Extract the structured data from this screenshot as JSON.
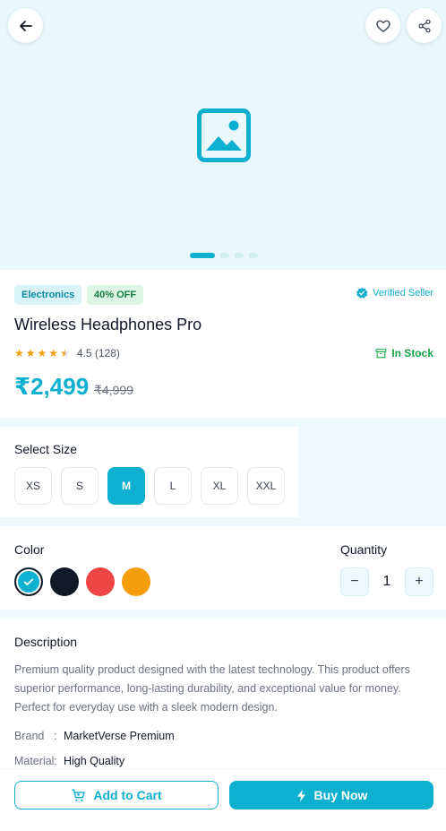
{
  "product": {
    "category": "Electronics",
    "discount": "40% OFF",
    "seller": "Verified Seller",
    "title": "Wireless Headphones Pro",
    "rating": "4.5",
    "reviews": "(128)",
    "rating_value": 4.5,
    "stock": "In Stock",
    "price": "₹2,499",
    "old_price": "₹4,999"
  },
  "gallery": {
    "active_index": 0,
    "count": 4
  },
  "size": {
    "label": "Select Size",
    "options": [
      "XS",
      "S",
      "M",
      "L",
      "XL",
      "XXL"
    ],
    "selected": "M"
  },
  "color": {
    "label": "Color",
    "options": [
      "#0eb0cf",
      "#111827",
      "#ef4444",
      "#f59e0b"
    ],
    "selected_index": 0
  },
  "quantity": {
    "label": "Quantity",
    "value": "1",
    "minus": "−",
    "plus": "+"
  },
  "description": {
    "title": "Description",
    "text": "Premium quality product designed with the latest technology. This product offers superior performance, long-lasting durability, and exceptional value for money. Perfect for everyday use with a sleek modern design.",
    "specs": [
      {
        "key": "Brand",
        "value": "MarketVerse Premium"
      },
      {
        "key": "Material",
        "value": "High Quality"
      }
    ]
  },
  "actions": {
    "add_to_cart": "Add to Cart",
    "buy_now": "Buy Now"
  },
  "colors": {
    "accent": "#0eb0cf",
    "success": "#16a34a",
    "star": "#f59e0b"
  }
}
